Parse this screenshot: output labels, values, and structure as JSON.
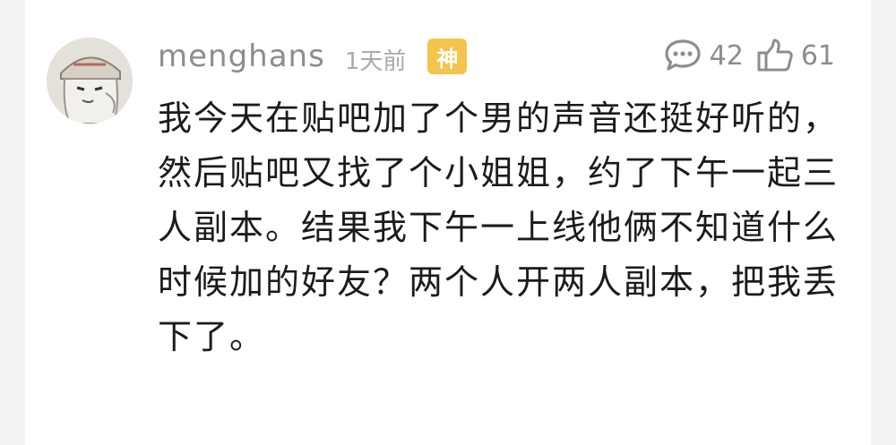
{
  "comment": {
    "username": "menghans",
    "time": "1天前",
    "badge": "神",
    "reply_count": "42",
    "like_count": "61",
    "text_lines": [
      "我今天在贴吧加了个男的声音还挺好听的，",
      "然后贴吧又找了个小姐姐，约了下午一起三",
      "人副本。结果我下午一上线他俩不知道什么",
      "时候加的好友？两个人开两人副本，把我丢",
      "下了。"
    ]
  },
  "icons": {
    "reply": "comment-bubble-icon",
    "like": "thumbs-up-icon"
  },
  "colors": {
    "badge": "#f5c44c",
    "meta_text": "#8d8d8d",
    "body_text": "#1b1b1b"
  }
}
